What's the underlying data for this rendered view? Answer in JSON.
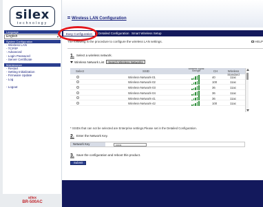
{
  "sidebar": {
    "logo_text": "silex",
    "logo_subtext": "technology",
    "language_header": "Language",
    "language_value": "English",
    "system_header": "System Configuration",
    "system_items": [
      "- Wireless LAN",
      "- TCP/IP",
      "- Advanced",
      "- Login Password",
      "- Server Certificate"
    ],
    "maintenance_header": "Maintenance",
    "maintenance_items": [
      "- Restart",
      "- Setting Initialization",
      "- Firmware Update",
      "- Log"
    ],
    "logout": "- Logout",
    "brand": "silex",
    "model": "BR-500AC"
  },
  "header": {
    "title": "Wireless LAN Configuration"
  },
  "tabs": [
    "Easy Configuration",
    "Detailed Configuration",
    "Smart Wireless Setup"
  ],
  "content": {
    "intro": "The following is the procedure to configure the wireless LAN settings.",
    "help_label": "HELP",
    "step1_num": "1.",
    "step1_text": "Select a wireless network.",
    "network_list_label": "Wireless Network List",
    "search_button": "Search Wireless Networks",
    "table_headers": {
      "select": "Select",
      "ssid": "SSID",
      "signal": "Wireless Signal Strength",
      "ch": "CH",
      "standard": "Wireless Standard"
    },
    "networks": [
      {
        "ssid": "Wireless-Network-01",
        "ch": "40",
        "standard": "11ac",
        "signal": 5
      },
      {
        "ssid": "Wireless-Network-02",
        "ch": "100",
        "standard": "11ac",
        "signal": 5
      },
      {
        "ssid": "Wireless-Network-03",
        "ch": "36",
        "standard": "11ac",
        "signal": 5
      },
      {
        "ssid": "Wireless-Network-04",
        "ch": "36",
        "standard": "11ac",
        "signal": 5
      },
      {
        "ssid": "Wireless-Network-41",
        "ch": "36",
        "standard": "11ac",
        "signal": 5
      },
      {
        "ssid": "Wireless-Network-42",
        "ch": "100",
        "standard": "11ac",
        "signal": 5
      }
    ],
    "note": "* SSIDs that can not be selected are Enterprise settings.Please set in the Detailed Configuration.",
    "step2_num": "2.",
    "step2_text": "Enter the Network Key.",
    "network_key_label": "Network Key",
    "network_key_value": "••••••",
    "step3_num": "3.",
    "step3_text": "Save the configuration and reboot this product.",
    "submit_label": "Submit"
  },
  "colors": {
    "accent_navy": "#13195c",
    "header_blue": "#2a3e8f",
    "brand_red": "#c0272d",
    "highlight_red": "#e4161b",
    "signal_green": "#2f8f3a"
  }
}
